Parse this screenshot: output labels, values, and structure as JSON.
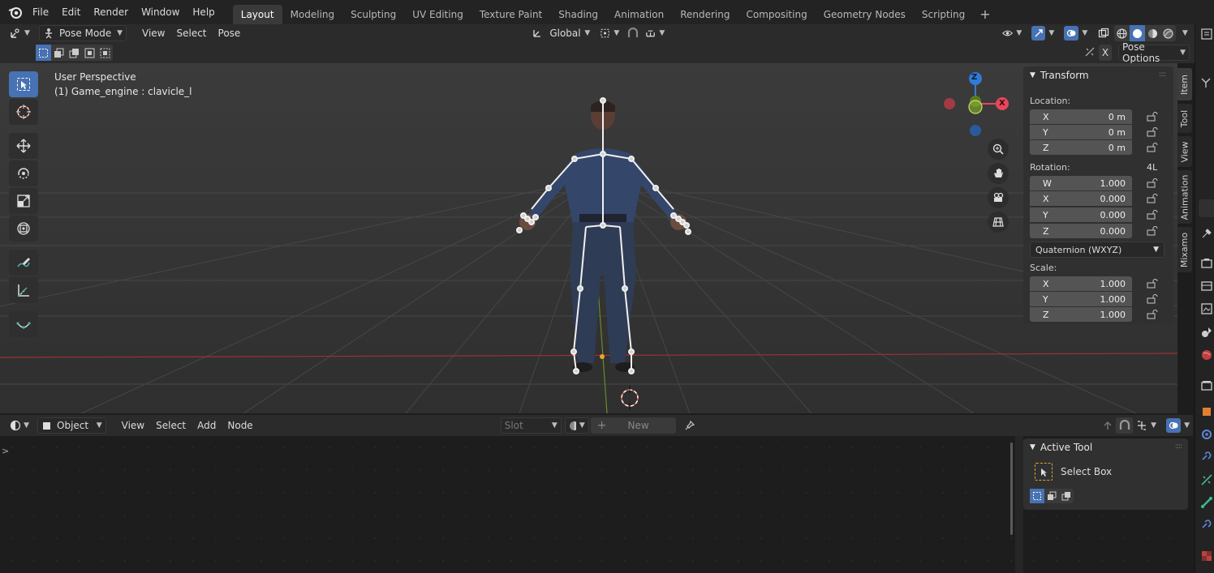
{
  "menu": [
    "File",
    "Edit",
    "Render",
    "Window",
    "Help"
  ],
  "workspaces": [
    "Layout",
    "Modeling",
    "Sculpting",
    "UV Editing",
    "Texture Paint",
    "Shading",
    "Animation",
    "Rendering",
    "Compositing",
    "Geometry Nodes",
    "Scripting"
  ],
  "workspace_add": "+",
  "viewport_header": {
    "mode": "Pose Mode",
    "menus": [
      "View",
      "Select",
      "Pose"
    ],
    "orientation": "Global",
    "pose_options": "Pose Options",
    "x_label": "X"
  },
  "viewport": {
    "perspective": "User Perspective",
    "object_info": "(1) Game_engine : clavicle_l"
  },
  "gizmo": {
    "z": "Z",
    "x": "X"
  },
  "transform": {
    "title": "Transform",
    "location_label": "Location:",
    "location": [
      {
        "axis": "X",
        "value": "0 m"
      },
      {
        "axis": "Y",
        "value": "0 m"
      },
      {
        "axis": "Z",
        "value": "0 m"
      }
    ],
    "rotation_label": "Rotation:",
    "rotation_lock": "4L",
    "rotation": [
      {
        "axis": "W",
        "value": "1.000"
      },
      {
        "axis": "X",
        "value": "0.000"
      },
      {
        "axis": "Y",
        "value": "0.000"
      },
      {
        "axis": "Z",
        "value": "0.000"
      }
    ],
    "rotation_mode": "Quaternion (WXYZ)",
    "scale_label": "Scale:",
    "scale": [
      {
        "axis": "X",
        "value": "1.000"
      },
      {
        "axis": "Y",
        "value": "1.000"
      },
      {
        "axis": "Z",
        "value": "1.000"
      }
    ]
  },
  "sidebar_tabs": [
    "Item",
    "Tool",
    "View",
    "Animation",
    "Mixamo"
  ],
  "node_editor": {
    "type": "Object",
    "menus": [
      "View",
      "Select",
      "Add",
      "Node"
    ],
    "slot": "Slot",
    "new_label": "New",
    "active_tool_title": "Active Tool",
    "active_tool_name": "Select Box",
    "expand_arrow": ">"
  },
  "colors": {
    "accent": "#4772b3",
    "axis_x": "#e5485a",
    "axis_y": "#8bb32a",
    "axis_z": "#2f7bd6",
    "grid_x_line": "#9e3036"
  }
}
